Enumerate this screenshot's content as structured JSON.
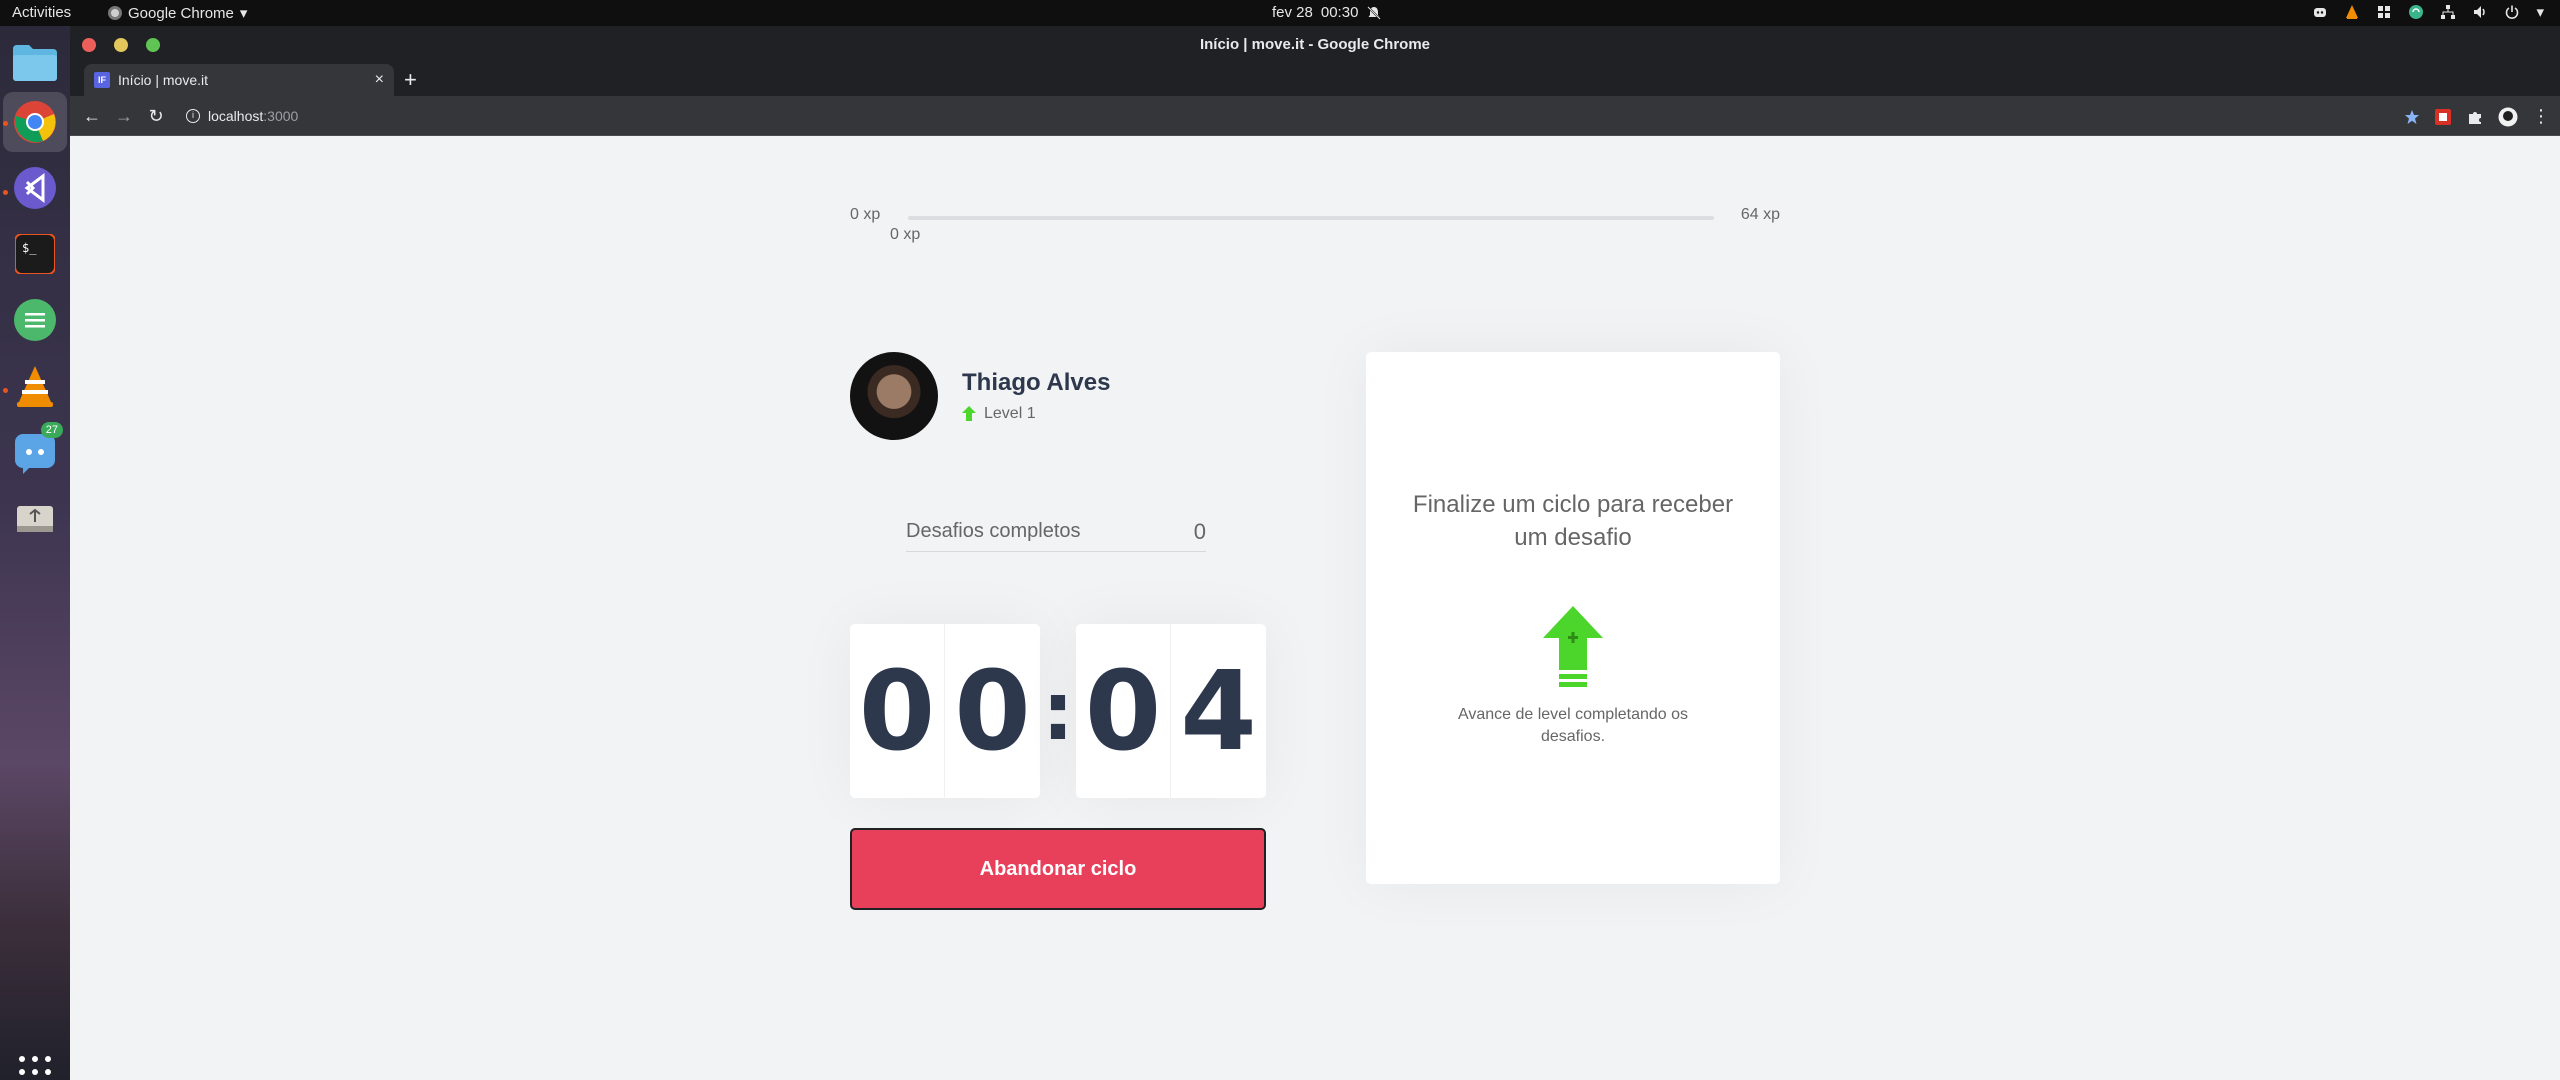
{
  "system": {
    "activities": "Activities",
    "app_menu": "Google Chrome",
    "date": "fev 28",
    "time": "00:30"
  },
  "dock": {
    "items": [
      "files",
      "chrome",
      "vscode",
      "terminal",
      "notes",
      "vlc",
      "discord",
      "usb-creator"
    ],
    "discord_badge": "27"
  },
  "browser": {
    "window_title": "Início | move.it - Google Chrome",
    "tab_title": "Início | move.it",
    "tab_favicon": "IF",
    "url_host": "localhost",
    "url_port": ":3000"
  },
  "xp": {
    "start": "0 xp",
    "end": "64 xp",
    "current": "0 xp",
    "progress_fraction": 0
  },
  "profile": {
    "name": "Thiago Alves",
    "level": "Level 1"
  },
  "stats": {
    "completed_label": "Desafios completos",
    "completed_value": "0"
  },
  "countdown": {
    "minute_left": "0",
    "minute_right": "0",
    "separator": ":",
    "second_left": "0",
    "second_right": "4"
  },
  "actions": {
    "abandon_label": "Abandonar ciclo"
  },
  "challenge": {
    "title": "Finalize um ciclo para receber um desafio",
    "description": "Avance de level completando os desafios."
  },
  "colors": {
    "accent_red": "#e83f5b",
    "accent_green": "#4cd62b",
    "title_text": "#2e384d",
    "body_text": "#666666"
  }
}
